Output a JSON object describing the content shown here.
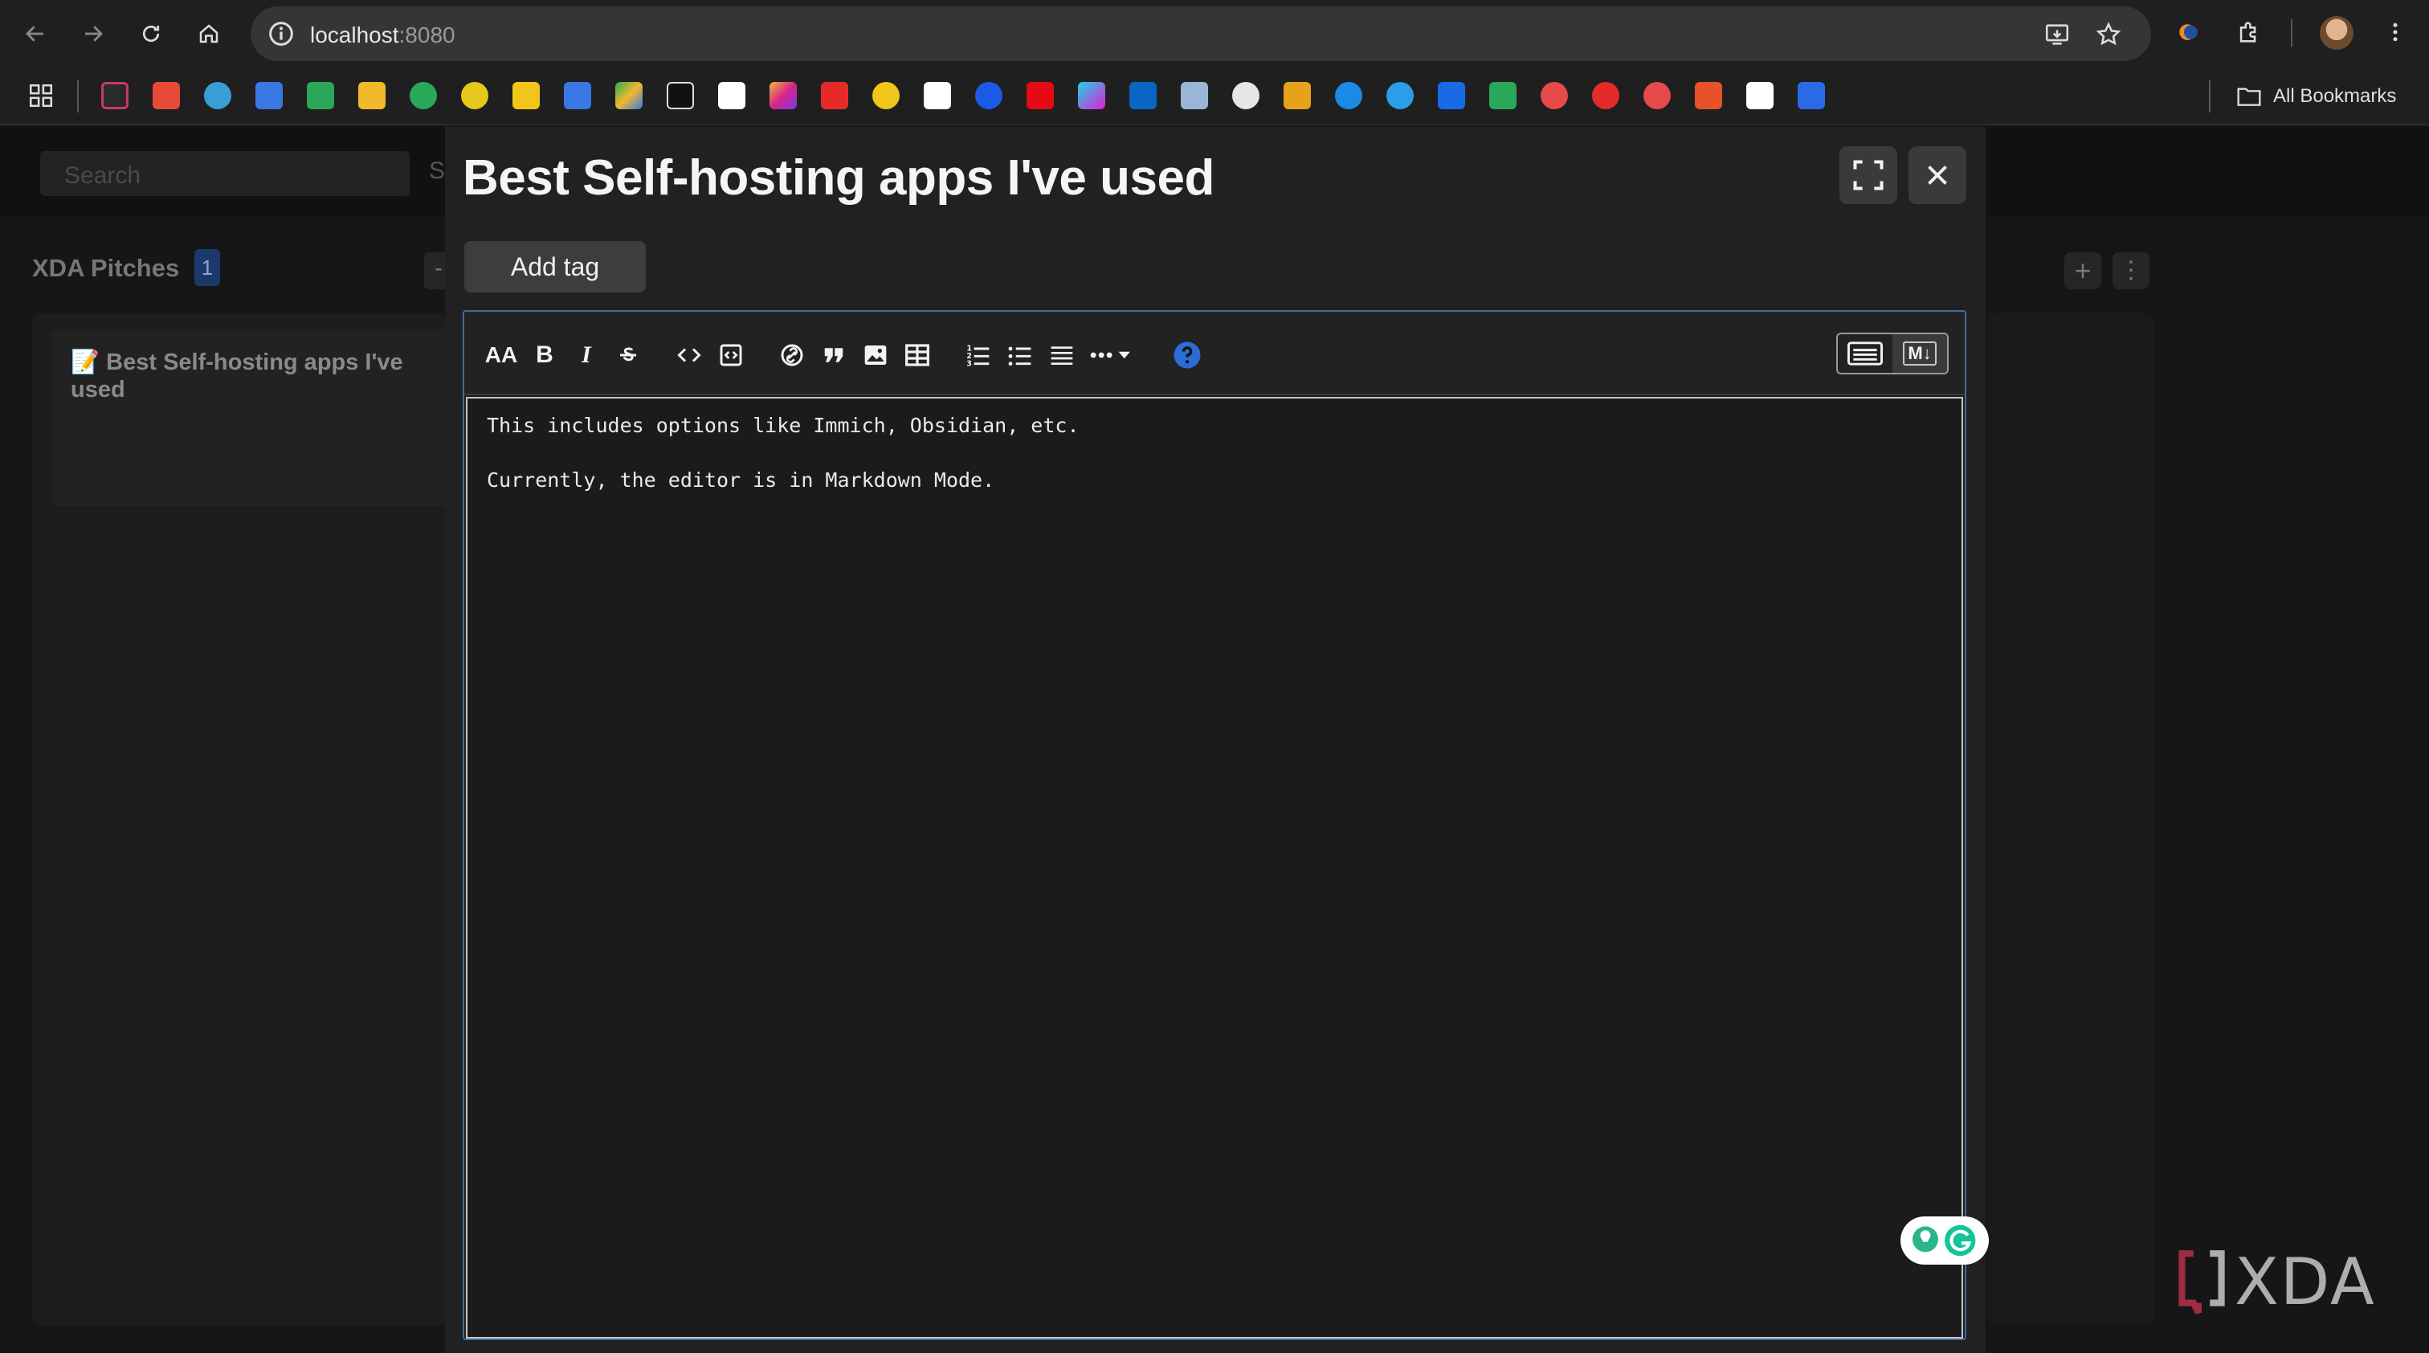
{
  "browser": {
    "url_host": "localhost",
    "url_port": ":8080",
    "all_bookmarks_label": "All Bookmarks"
  },
  "app": {
    "search_placeholder": "Search",
    "s_fragment": "S",
    "board_title": "XDA Pitches",
    "board_count": "1",
    "card_emoji": "📝",
    "card_title": "Best Self-hosting apps I've used",
    "dash": "-"
  },
  "modal": {
    "title": "Best Self-hosting apps I've used",
    "add_tag_label": "Add tag",
    "heading_tool": "AA",
    "bold_tool": "B",
    "italic_tool": "I",
    "content_lines": [
      "This includes options like Immich, Obsidian, etc.",
      "Currently, the editor is in Markdown Mode."
    ],
    "mode_md": "M↓"
  },
  "watermark": {
    "text": "XDA"
  },
  "colors": {
    "accent": "#3f6d9e",
    "help": "#2d6bd6",
    "badge": "#1b3a6b"
  }
}
